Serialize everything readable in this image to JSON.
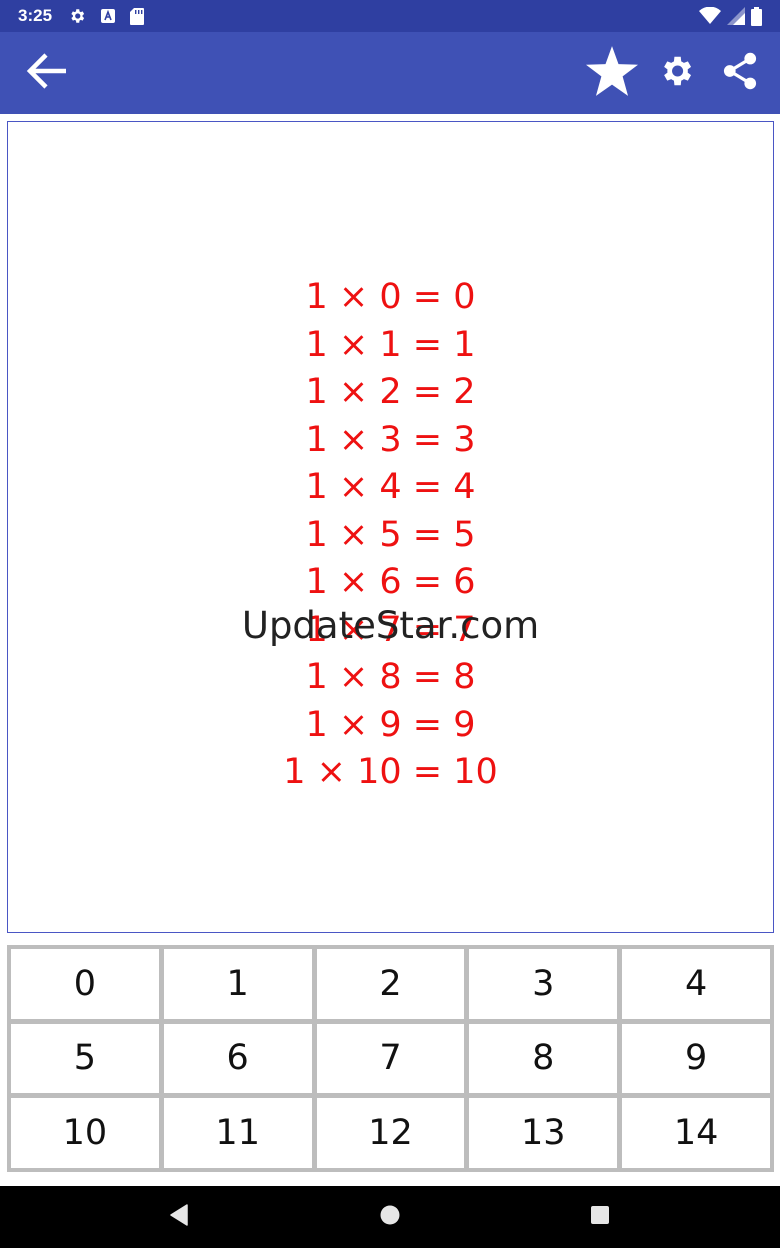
{
  "status_bar": {
    "time": "3:25",
    "left_icons": [
      "settings-icon",
      "text-a-icon",
      "sd-card-icon"
    ],
    "right_icons": [
      "wifi-icon",
      "signal-icon",
      "battery-icon"
    ]
  },
  "toolbar": {
    "background_color": "#3f51b5",
    "icons": [
      "arrow-left-icon",
      "star-icon",
      "gear-icon",
      "share-icon"
    ]
  },
  "table": {
    "text_color": "#ee1111",
    "lines": [
      "1 × 0 = 0",
      "1 × 1 = 1",
      "1 × 2 = 2",
      "1 × 3 = 3",
      "1 × 4 = 4",
      "1 × 5 = 5",
      "1 × 6 = 6",
      "1 × 7 = 7",
      "1 × 8 = 8",
      "1 × 9 = 9",
      "1 × 10 = 10"
    ]
  },
  "watermark": "UpdateStar.com",
  "keypad": {
    "keys": [
      "0",
      "1",
      "2",
      "3",
      "4",
      "5",
      "6",
      "7",
      "8",
      "9",
      "10",
      "11",
      "12",
      "13",
      "14"
    ]
  },
  "nav_bar": {
    "icons": [
      "back-triangle-icon",
      "home-circle-icon",
      "recents-square-icon"
    ]
  }
}
